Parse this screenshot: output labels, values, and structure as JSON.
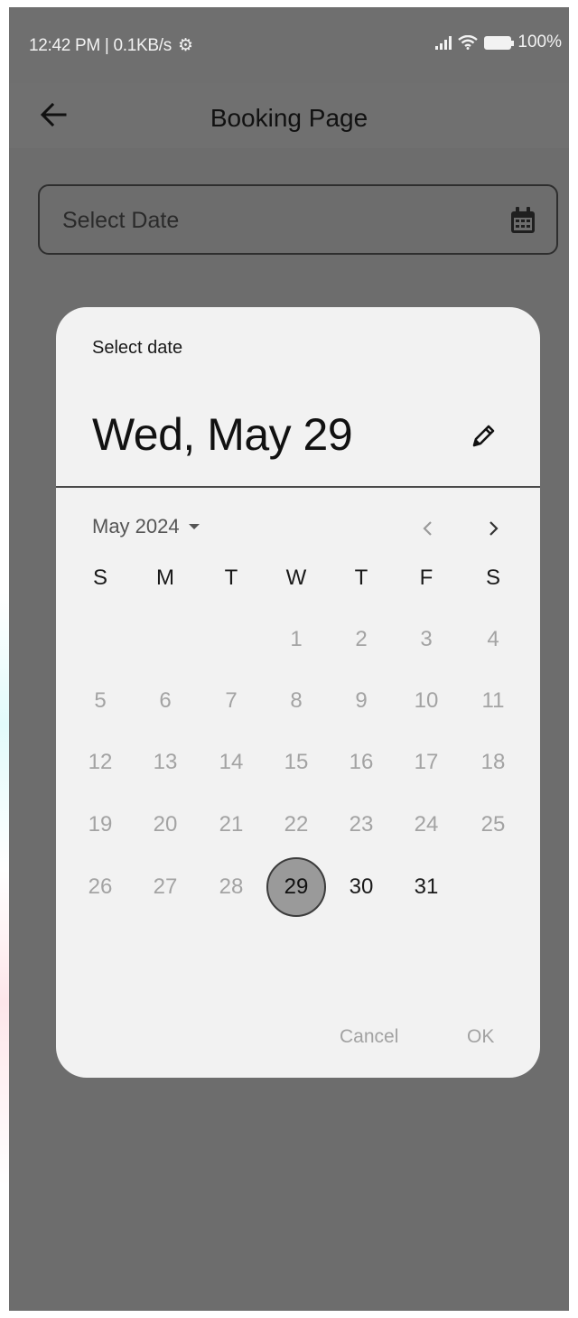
{
  "status_bar": {
    "time_speed": "12:42 PM | 0.1KB/s",
    "battery_text": "100%"
  },
  "app_bar": {
    "title": "Booking Page"
  },
  "date_field": {
    "placeholder": "Select Date"
  },
  "dialog": {
    "label": "Select date",
    "selected_date_text": "Wed, May 29",
    "month_label": "May 2024",
    "weekdays": [
      "S",
      "M",
      "T",
      "W",
      "T",
      "F",
      "S"
    ],
    "days": [
      "1",
      "2",
      "3",
      "4",
      "5",
      "6",
      "7",
      "8",
      "9",
      "10",
      "11",
      "12",
      "13",
      "14",
      "15",
      "16",
      "17",
      "18",
      "19",
      "20",
      "21",
      "22",
      "23",
      "24",
      "25",
      "26",
      "27",
      "28",
      "29",
      "30",
      "31"
    ],
    "first_weekday_index": 3,
    "selected_day": "29",
    "today_day": "29",
    "cancel_label": "Cancel",
    "ok_label": "OK"
  },
  "colors": {
    "scrim": "#6d6d6d",
    "dialog_bg": "#f2f2f2",
    "selected_circle": "#9a9a9a",
    "disabled_text": "#a3a3a3"
  }
}
